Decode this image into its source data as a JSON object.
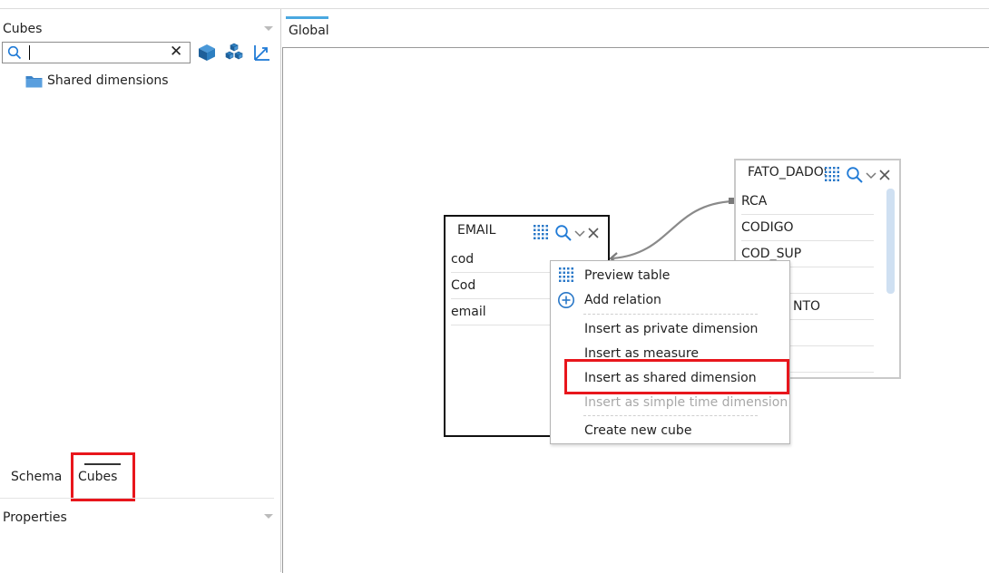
{
  "cubes_panel": {
    "title": "Cubes",
    "search": {
      "value": "",
      "placeholder": "",
      "clear_glyph": "✕"
    },
    "tree": [
      {
        "label": "Shared dimensions",
        "icon": "folder-icon"
      }
    ]
  },
  "bottom_tabs": [
    {
      "label": "Schema",
      "active": false
    },
    {
      "label": "Cubes",
      "active": true
    }
  ],
  "properties_panel": {
    "title": "Properties"
  },
  "editor_tabs": [
    {
      "label": "Global",
      "active": true
    }
  ],
  "tables": {
    "email": {
      "title": "EMAIL",
      "rows": [
        "cod",
        "Cod",
        "email"
      ]
    },
    "fato": {
      "title": "FATO_DADOS",
      "rows": [
        "RCA",
        "CODIGO",
        "COD_SUP",
        "",
        "NTO",
        "",
        ""
      ]
    }
  },
  "context_menu": {
    "items": [
      {
        "label": "Preview table",
        "icon": "grid-icon",
        "disabled": false
      },
      {
        "label": "Add relation",
        "icon": "plus-circle-icon",
        "disabled": false
      },
      {
        "label": "Insert as private dimension",
        "disabled": false
      },
      {
        "label": "Insert as measure",
        "disabled": false
      },
      {
        "label": "Insert as shared dimension",
        "disabled": false,
        "highlighted": true
      },
      {
        "label": "Insert as simple time dimension",
        "disabled": true
      },
      {
        "label": "Create new cube",
        "disabled": false
      }
    ]
  },
  "colors": {
    "highlight_red": "#e8161c",
    "accent_blue": "#1f7ad6",
    "tab_active_blue": "#4aa8e0",
    "cube_icon": "#2d7fc1",
    "folder": "#3b83c8"
  }
}
